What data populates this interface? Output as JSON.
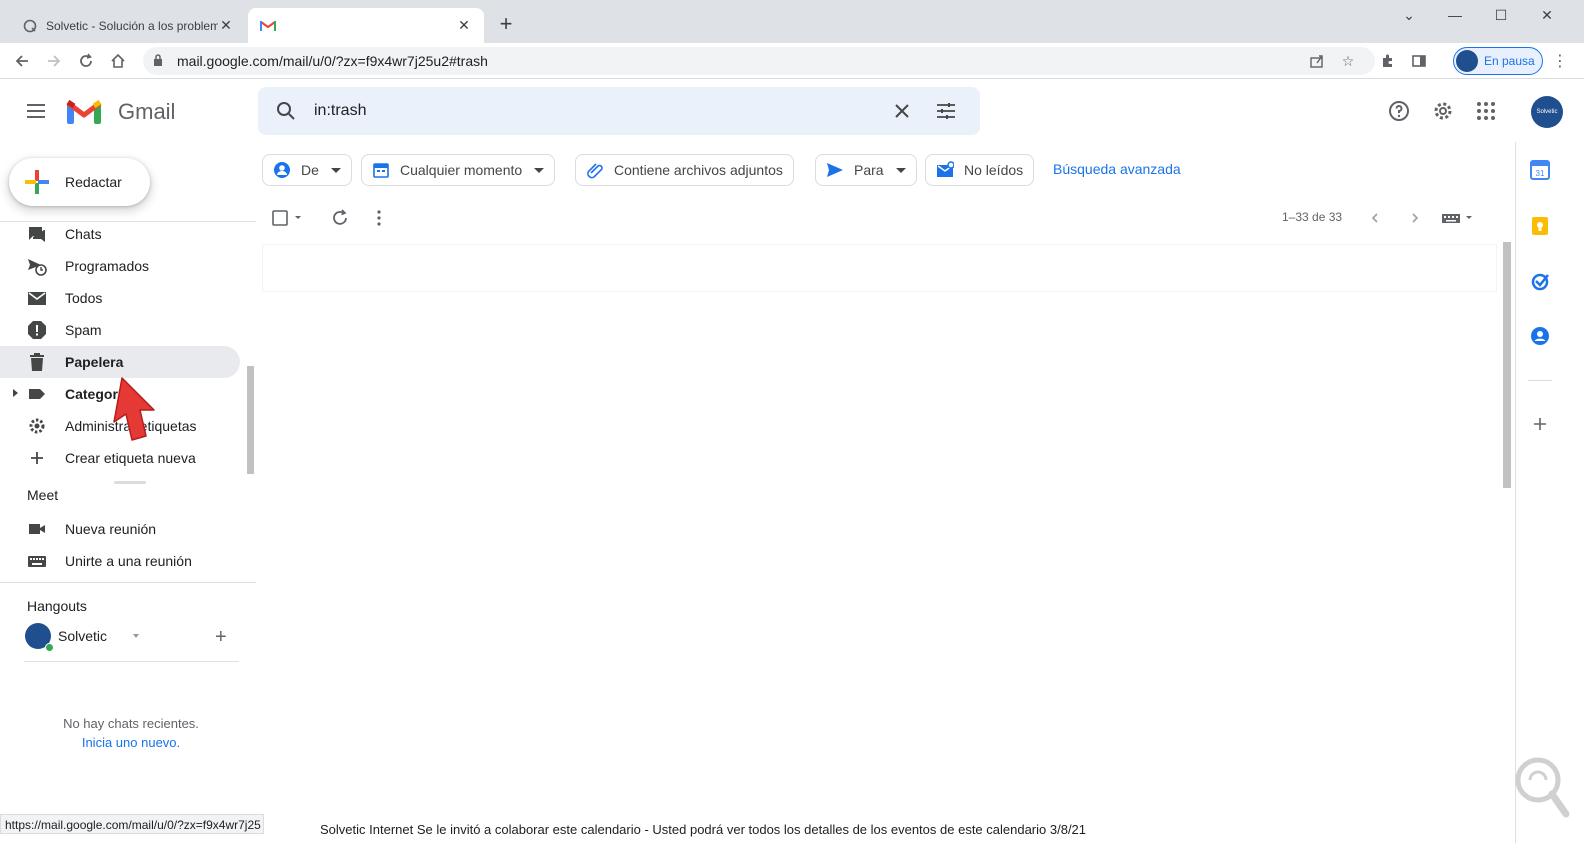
{
  "browser": {
    "tabs": [
      {
        "title": "Solvetic - Solución a los problem",
        "active": false
      },
      {
        "title": "",
        "active": true
      }
    ],
    "url": "mail.google.com/mail/u/0/?zx=f9x4wr7j25u2#trash",
    "profile_label": "En pausa",
    "status_url": "https://mail.google.com/mail/u/0/?zx=f9x4wr7j25"
  },
  "gmail": {
    "brand": "Gmail",
    "search": {
      "value": "in:trash"
    },
    "avatar_text": "Solvetic"
  },
  "nav": {
    "compose_label": "Redactar",
    "items": [
      {
        "label": "Chats",
        "icon": "chat-icon"
      },
      {
        "label": "Programados",
        "icon": "scheduled-icon"
      },
      {
        "label": "Todos",
        "icon": "mail-icon"
      },
      {
        "label": "Spam",
        "icon": "spam-icon"
      },
      {
        "label": "Papelera",
        "icon": "trash-icon",
        "selected": true
      },
      {
        "label": "Categorías",
        "icon": "label-icon"
      },
      {
        "label": "Administrar etiquetas",
        "icon": "gear-icon"
      },
      {
        "label": "Crear etiqueta nueva",
        "icon": "plus-icon"
      }
    ],
    "meet": {
      "title": "Meet",
      "items": [
        {
          "label": "Nueva reunión",
          "icon": "video-icon"
        },
        {
          "label": "Unirte a una reunión",
          "icon": "keyboard-icon"
        }
      ]
    },
    "hangouts": {
      "title": "Hangouts",
      "user": "Solvetic",
      "no_chats": "No hay chats recientes.",
      "start_link": "Inicia uno nuevo."
    }
  },
  "filters": {
    "chips": [
      {
        "label": "De",
        "icon": "person-icon",
        "dropdown": true
      },
      {
        "label": "Cualquier momento",
        "icon": "calendar-icon",
        "dropdown": true
      },
      {
        "label": "Contiene archivos adjuntos",
        "icon": "attachment-icon",
        "dropdown": false
      },
      {
        "label": "Para",
        "icon": "send-icon",
        "dropdown": true
      },
      {
        "label": "No leídos",
        "icon": "unread-icon",
        "dropdown": false
      }
    ],
    "advanced": "Búsqueda avanzada"
  },
  "toolbar": {
    "pager": "1–33 de 33"
  },
  "list": {
    "partial_row_text": "Solvetic Internet          Se le invitó a colaborar este calendario - Usted podrá ver todos los detalles de los eventos de este calendario                                        3/8/21"
  },
  "colors": {
    "accent": "#1a73e8",
    "selected_bg": "#e8eaed",
    "search_bg": "#eaf1fb",
    "arrow": "#e53935"
  }
}
